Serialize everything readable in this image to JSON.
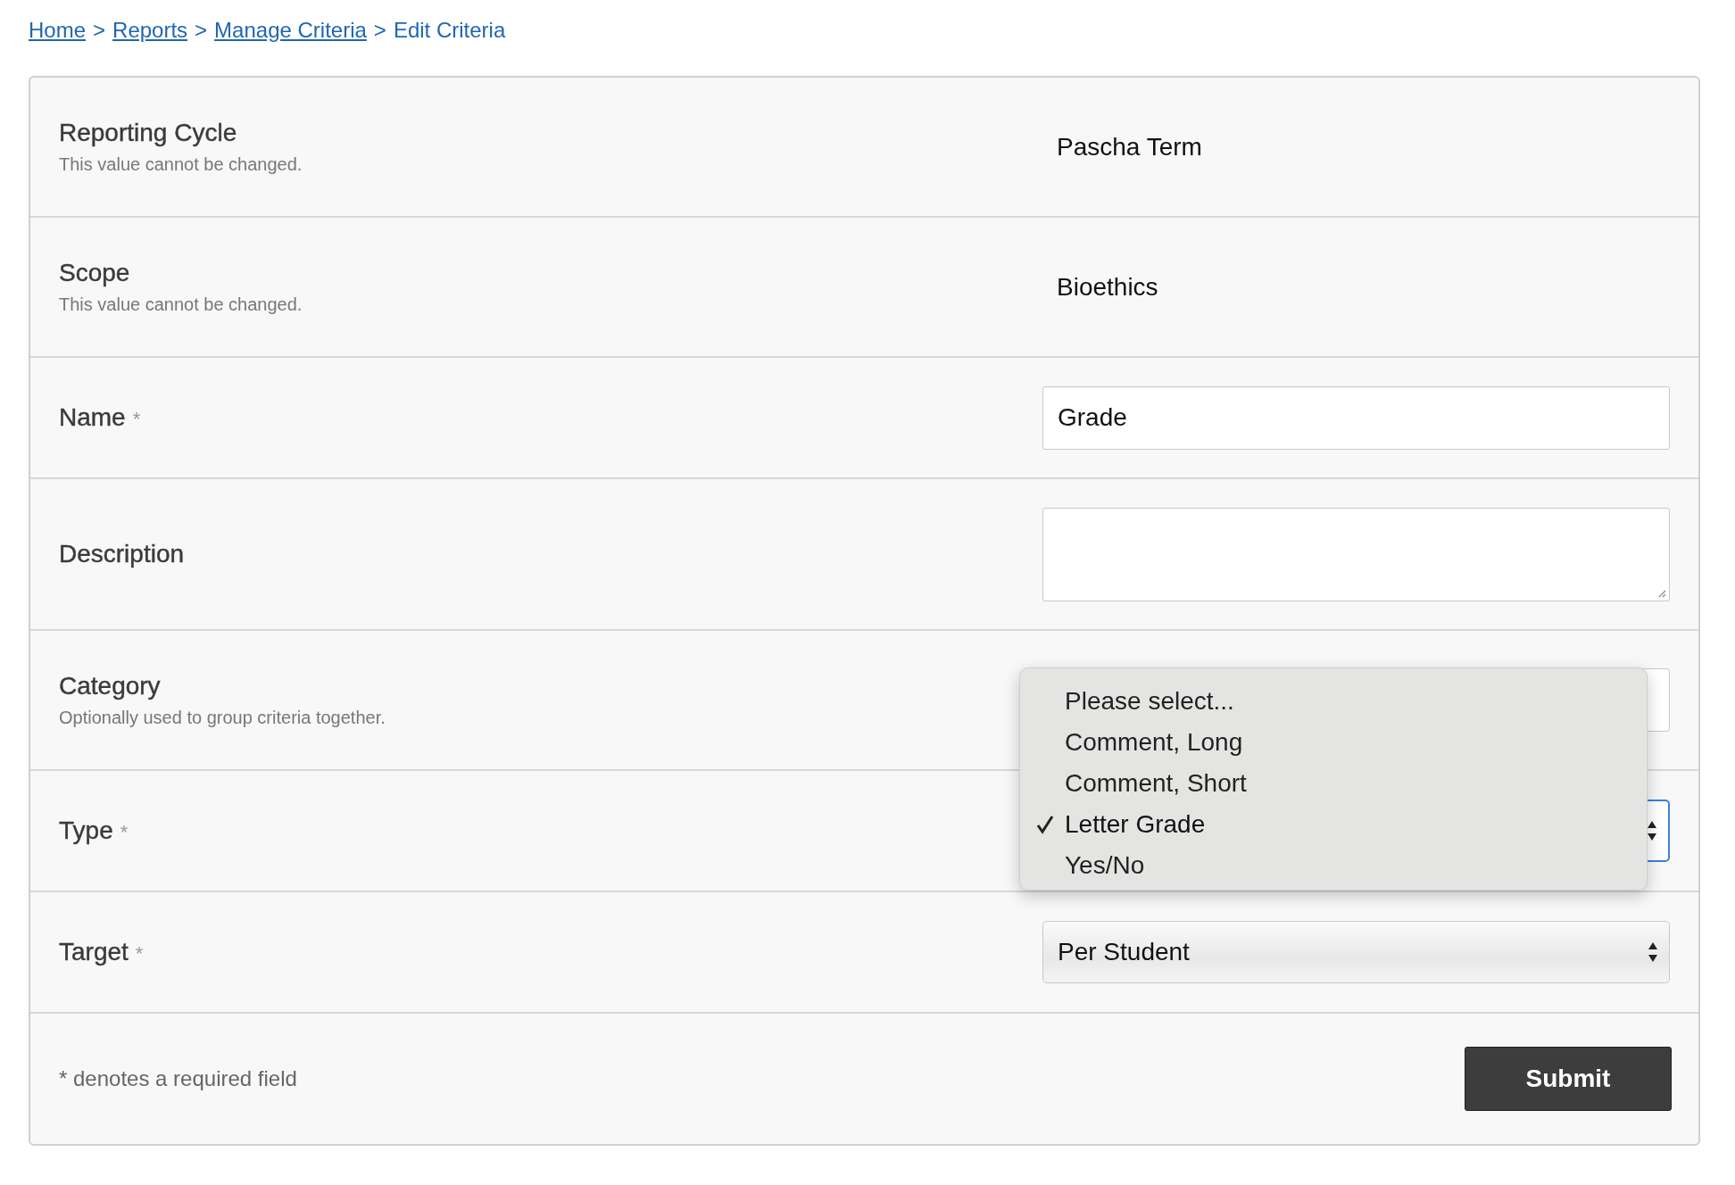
{
  "breadcrumb": {
    "links": [
      "Home",
      "Reports",
      "Manage Criteria"
    ],
    "separator": ">",
    "current": "Edit Criteria"
  },
  "rows": [
    {
      "kind": "static",
      "label": "Reporting Cycle",
      "hint": "This value cannot be changed.",
      "value": "Pascha Term"
    },
    {
      "kind": "static",
      "label": "Scope",
      "hint": "This value cannot be changed.",
      "value": "Bioethics"
    },
    {
      "kind": "text",
      "label": "Name",
      "mark": "*",
      "value": "Grade"
    },
    {
      "kind": "textarea",
      "label": "Description"
    },
    {
      "kind": "text",
      "label": "Category",
      "hint": "Optionally used to group criteria together."
    },
    {
      "kind": "select",
      "label": "Type",
      "mark": "*",
      "focused": true
    },
    {
      "kind": "select",
      "label": "Target",
      "mark": "*",
      "value": "Per Student",
      "focused": false
    }
  ],
  "dropdown": {
    "options": [
      {
        "label": "Please select...",
        "selected": false
      },
      {
        "label": "Comment, Long",
        "selected": false
      },
      {
        "label": "Comment, Short",
        "selected": false
      },
      {
        "label": "Letter Grade",
        "selected": true
      },
      {
        "label": "Yes/No",
        "selected": false
      }
    ]
  },
  "footer": {
    "note": "* denotes a required field",
    "submit": "Submit"
  }
}
